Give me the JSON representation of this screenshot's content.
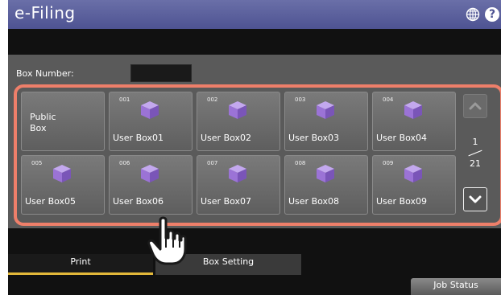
{
  "header": {
    "title": "e-Filing",
    "help_label": "?"
  },
  "box_number": {
    "label": "Box Number:",
    "value": ""
  },
  "boxes": [
    {
      "number": "",
      "name": "Public\nBox"
    },
    {
      "number": "001",
      "name": "User Box01"
    },
    {
      "number": "002",
      "name": "User Box02"
    },
    {
      "number": "003",
      "name": "User Box03"
    },
    {
      "number": "004",
      "name": "User Box04"
    },
    {
      "number": "005",
      "name": "User Box05"
    },
    {
      "number": "006",
      "name": "User Box06"
    },
    {
      "number": "007",
      "name": "User Box07"
    },
    {
      "number": "008",
      "name": "User Box08"
    },
    {
      "number": "009",
      "name": "User Box09"
    }
  ],
  "pager": {
    "current": "1",
    "total": "21"
  },
  "tabs": [
    {
      "label": "Print"
    },
    {
      "label": "Box Setting"
    }
  ],
  "footer": {
    "job_status": "Job Status"
  },
  "colors": {
    "title_bar": "#5a5f9e",
    "highlight": "#ee7f6a",
    "active_tab": "#e2b83a",
    "box_icon": "#9b73d6"
  }
}
